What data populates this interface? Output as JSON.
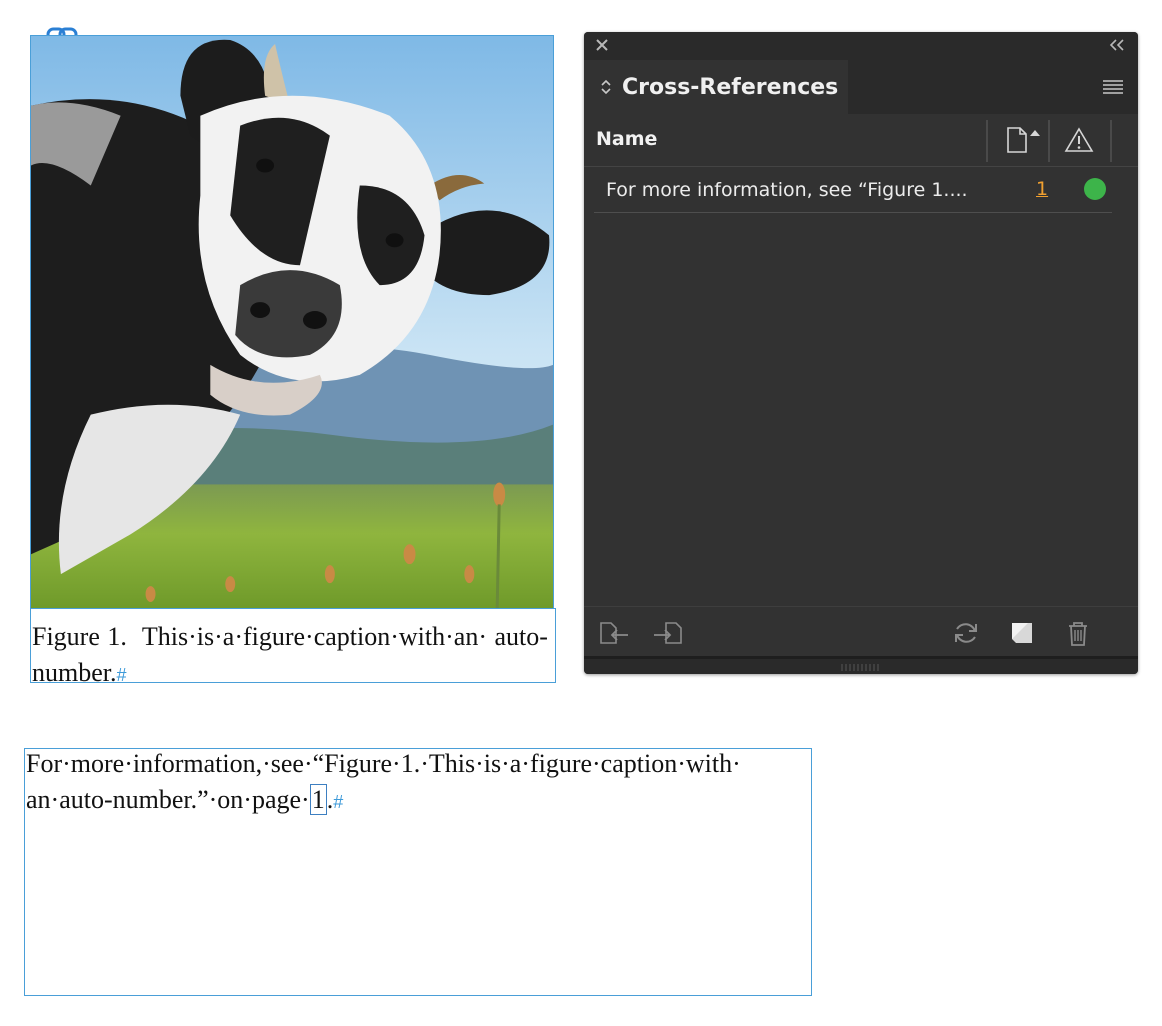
{
  "document": {
    "caption": {
      "number": "Figure 1.",
      "text": "This·is·a·figure·caption·with·an· auto-number.",
      "end_marker": "#"
    },
    "body": {
      "before_ref": "For·more·information,·see·“Figure·1.·This·is·a·figure·caption·with· an·auto-number.”·on·page·",
      "ref_value": "1",
      "after_ref": ".",
      "end_marker": "#"
    },
    "icons": {
      "link_badge": "link-icon"
    }
  },
  "panel": {
    "title": "Cross-References",
    "columns": {
      "name": "Name",
      "page_icon": "page-icon",
      "status_icon": "warning-icon"
    },
    "rows": [
      {
        "name": "For more information, see “Figure 1....",
        "page": "1",
        "status": "ok",
        "status_color": "#3db44a"
      }
    ],
    "footer_icons": {
      "go_to_source": "go-to-source-icon",
      "go_to_destination": "go-to-destination-icon",
      "update": "refresh-icon",
      "new": "new-cross-reference-icon",
      "delete": "trash-icon"
    },
    "colors": {
      "background": "#323232",
      "accent": "#f0a030",
      "frame": "#4a9fd8"
    }
  }
}
